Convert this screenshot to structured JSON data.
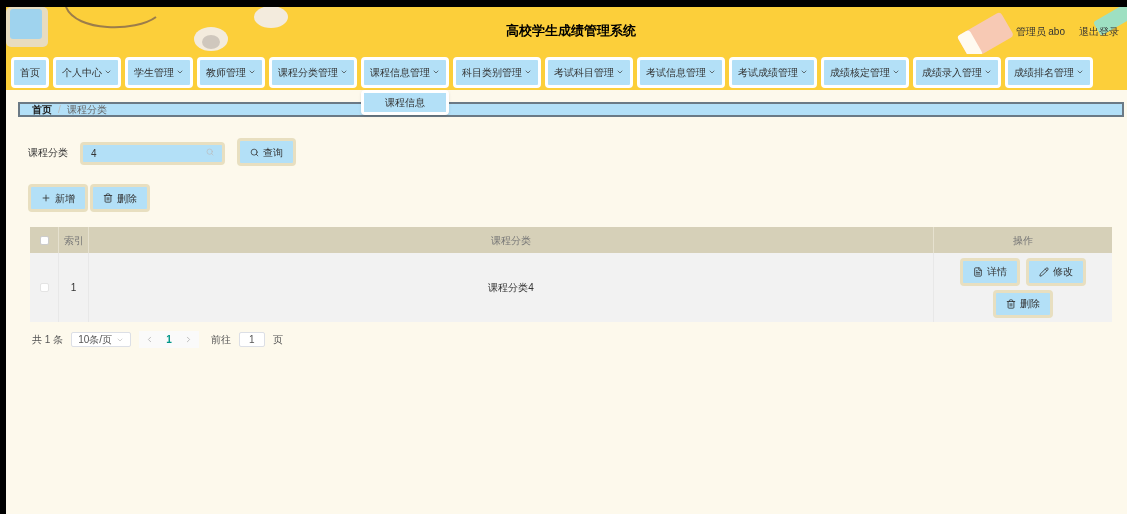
{
  "header": {
    "title": "高校学生成绩管理系统",
    "user": "管理员 abo",
    "logout": "退出登录"
  },
  "nav": [
    {
      "label": "首页",
      "has_caret": false
    },
    {
      "label": "个人中心",
      "has_caret": true
    },
    {
      "label": "学生管理",
      "has_caret": true
    },
    {
      "label": "教师管理",
      "has_caret": true
    },
    {
      "label": "课程分类管理",
      "has_caret": true
    },
    {
      "label": "课程信息管理",
      "has_caret": true,
      "children": [
        "课程信息"
      ]
    },
    {
      "label": "科目类别管理",
      "has_caret": true
    },
    {
      "label": "考试科目管理",
      "has_caret": true
    },
    {
      "label": "考试信息管理",
      "has_caret": true
    },
    {
      "label": "考试成绩管理",
      "has_caret": true
    },
    {
      "label": "成绩核定管理",
      "has_caret": true
    },
    {
      "label": "成绩录入管理",
      "has_caret": true
    },
    {
      "label": "成绩排名管理",
      "has_caret": true
    }
  ],
  "breadcrumb": {
    "items": [
      "首页",
      "课程分类"
    ],
    "separator": "/"
  },
  "search": {
    "label": "课程分类",
    "value": "4",
    "button": "查询"
  },
  "actions": [
    "新增",
    "删除"
  ],
  "table": {
    "header_checked": false,
    "columns": [
      "索引",
      "课程分类",
      "操作"
    ],
    "rows": [
      {
        "checked": false,
        "index": "1",
        "category": "课程分类4",
        "buttons": [
          "详情",
          "修改",
          "删除"
        ]
      }
    ]
  },
  "pagination": {
    "total": "共 1 条",
    "page_size": "10条/页",
    "pages": [
      {
        "label": "1",
        "selected": true
      }
    ],
    "goto": "前往",
    "goto_value": "1",
    "unit": "页"
  }
}
